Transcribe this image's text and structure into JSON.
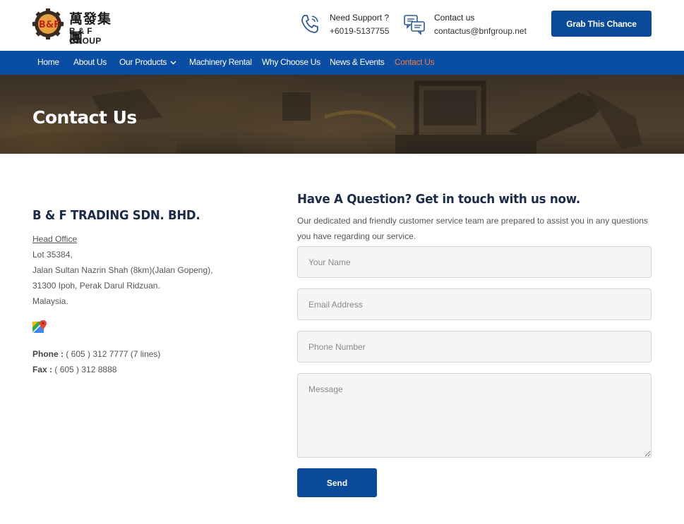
{
  "brand": {
    "logo_badge": "B&F",
    "name_cn": "萬發集團",
    "name_en": "B & F GROUP",
    "accent": "#0a4ea3",
    "highlight": "#f07b3f"
  },
  "header": {
    "support": {
      "icon": "phone-icon",
      "label": "Need Support ?",
      "value": "+6019-5137755"
    },
    "contact": {
      "icon": "chat-icon",
      "label": "Contact us",
      "value": "contactus@bnfgroup.net"
    },
    "cta_label": "Grab This Chance"
  },
  "nav": {
    "items": [
      {
        "label": "Home",
        "active": false
      },
      {
        "label": "About Us",
        "active": false
      },
      {
        "label": "Our Products",
        "active": false,
        "has_dropdown": true
      },
      {
        "label": "Machinery Rental",
        "active": false
      },
      {
        "label": "Why Choose Us",
        "active": false
      },
      {
        "label": "News & Events",
        "active": false
      },
      {
        "label": "Contact Us",
        "active": true
      }
    ]
  },
  "banner": {
    "title": "Contact Us"
  },
  "company": {
    "name": "B & F TRADING SDN. BHD.",
    "office_label": "Head Office",
    "address": [
      "Lot 35384,",
      "Jalan Sultan Nazrin Shah (8km)(Jalan Gopeng),",
      "31300 Ipoh, Perak Darul Ridzuan.",
      "Malaysia."
    ],
    "map_icon": "google-maps-icon",
    "phone_label": "Phone :",
    "phone_value": "( 605 ) 312 7777 (7 lines)",
    "fax_label": "Fax :",
    "fax_value": "( 605 ) 312 8888"
  },
  "form": {
    "title": "Have A Question? Get in touch with us now.",
    "description": "Our dedicated and friendly customer service team are prepared to assist you in any questions you have regarding our service.",
    "name_placeholder": "Your Name",
    "email_placeholder": "Email Address",
    "phone_placeholder": "Phone Number",
    "message_placeholder": "Message",
    "submit_label": "Send"
  }
}
